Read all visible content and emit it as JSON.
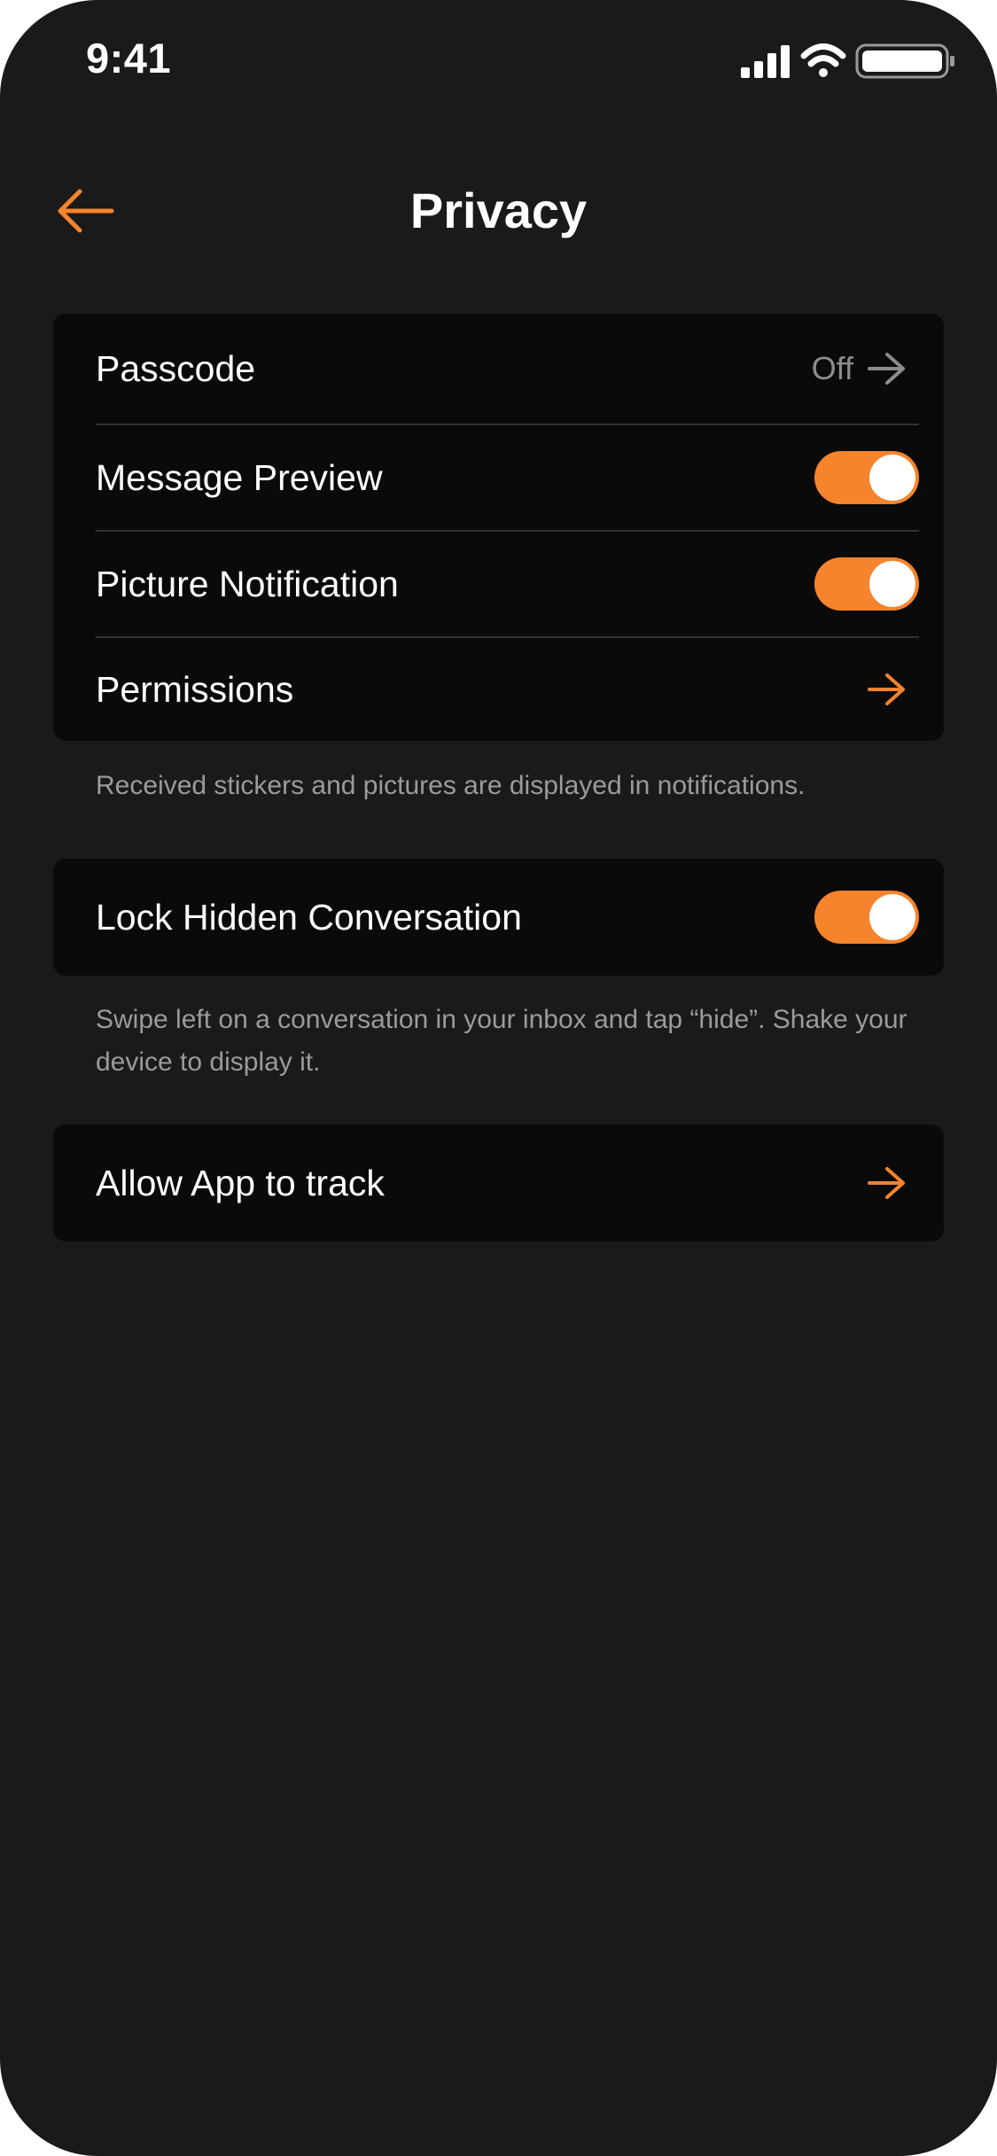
{
  "status_bar": {
    "time": "9:41",
    "icons": [
      "cellular-signal-icon",
      "wifi-icon",
      "battery-icon"
    ]
  },
  "header": {
    "title": "Privacy",
    "back_icon": "arrow-left-icon"
  },
  "colors": {
    "accent": "#f5842c",
    "background": "#1a1a1a",
    "card": "#0a0a0a",
    "secondary_text": "#9b9b9b"
  },
  "section1": {
    "passcode": {
      "label": "Passcode",
      "value": "Off",
      "icon": "arrow-right-icon"
    },
    "message_preview": {
      "label": "Message Preview",
      "toggle_on": true
    },
    "picture_notification": {
      "label": "Picture Notification",
      "toggle_on": true
    },
    "permissions": {
      "label": "Permissions",
      "icon": "arrow-right-icon"
    },
    "footnote": "Received stickers and pictures are displayed in notifications."
  },
  "section2": {
    "lock_hidden": {
      "label": "Lock Hidden Conversation",
      "toggle_on": true
    },
    "footnote": "Swipe left on a conversation in your inbox and tap “hide”. Shake your device to display it."
  },
  "section3": {
    "allow_tracking": {
      "label": "Allow App to track",
      "icon": "arrow-right-icon"
    }
  }
}
